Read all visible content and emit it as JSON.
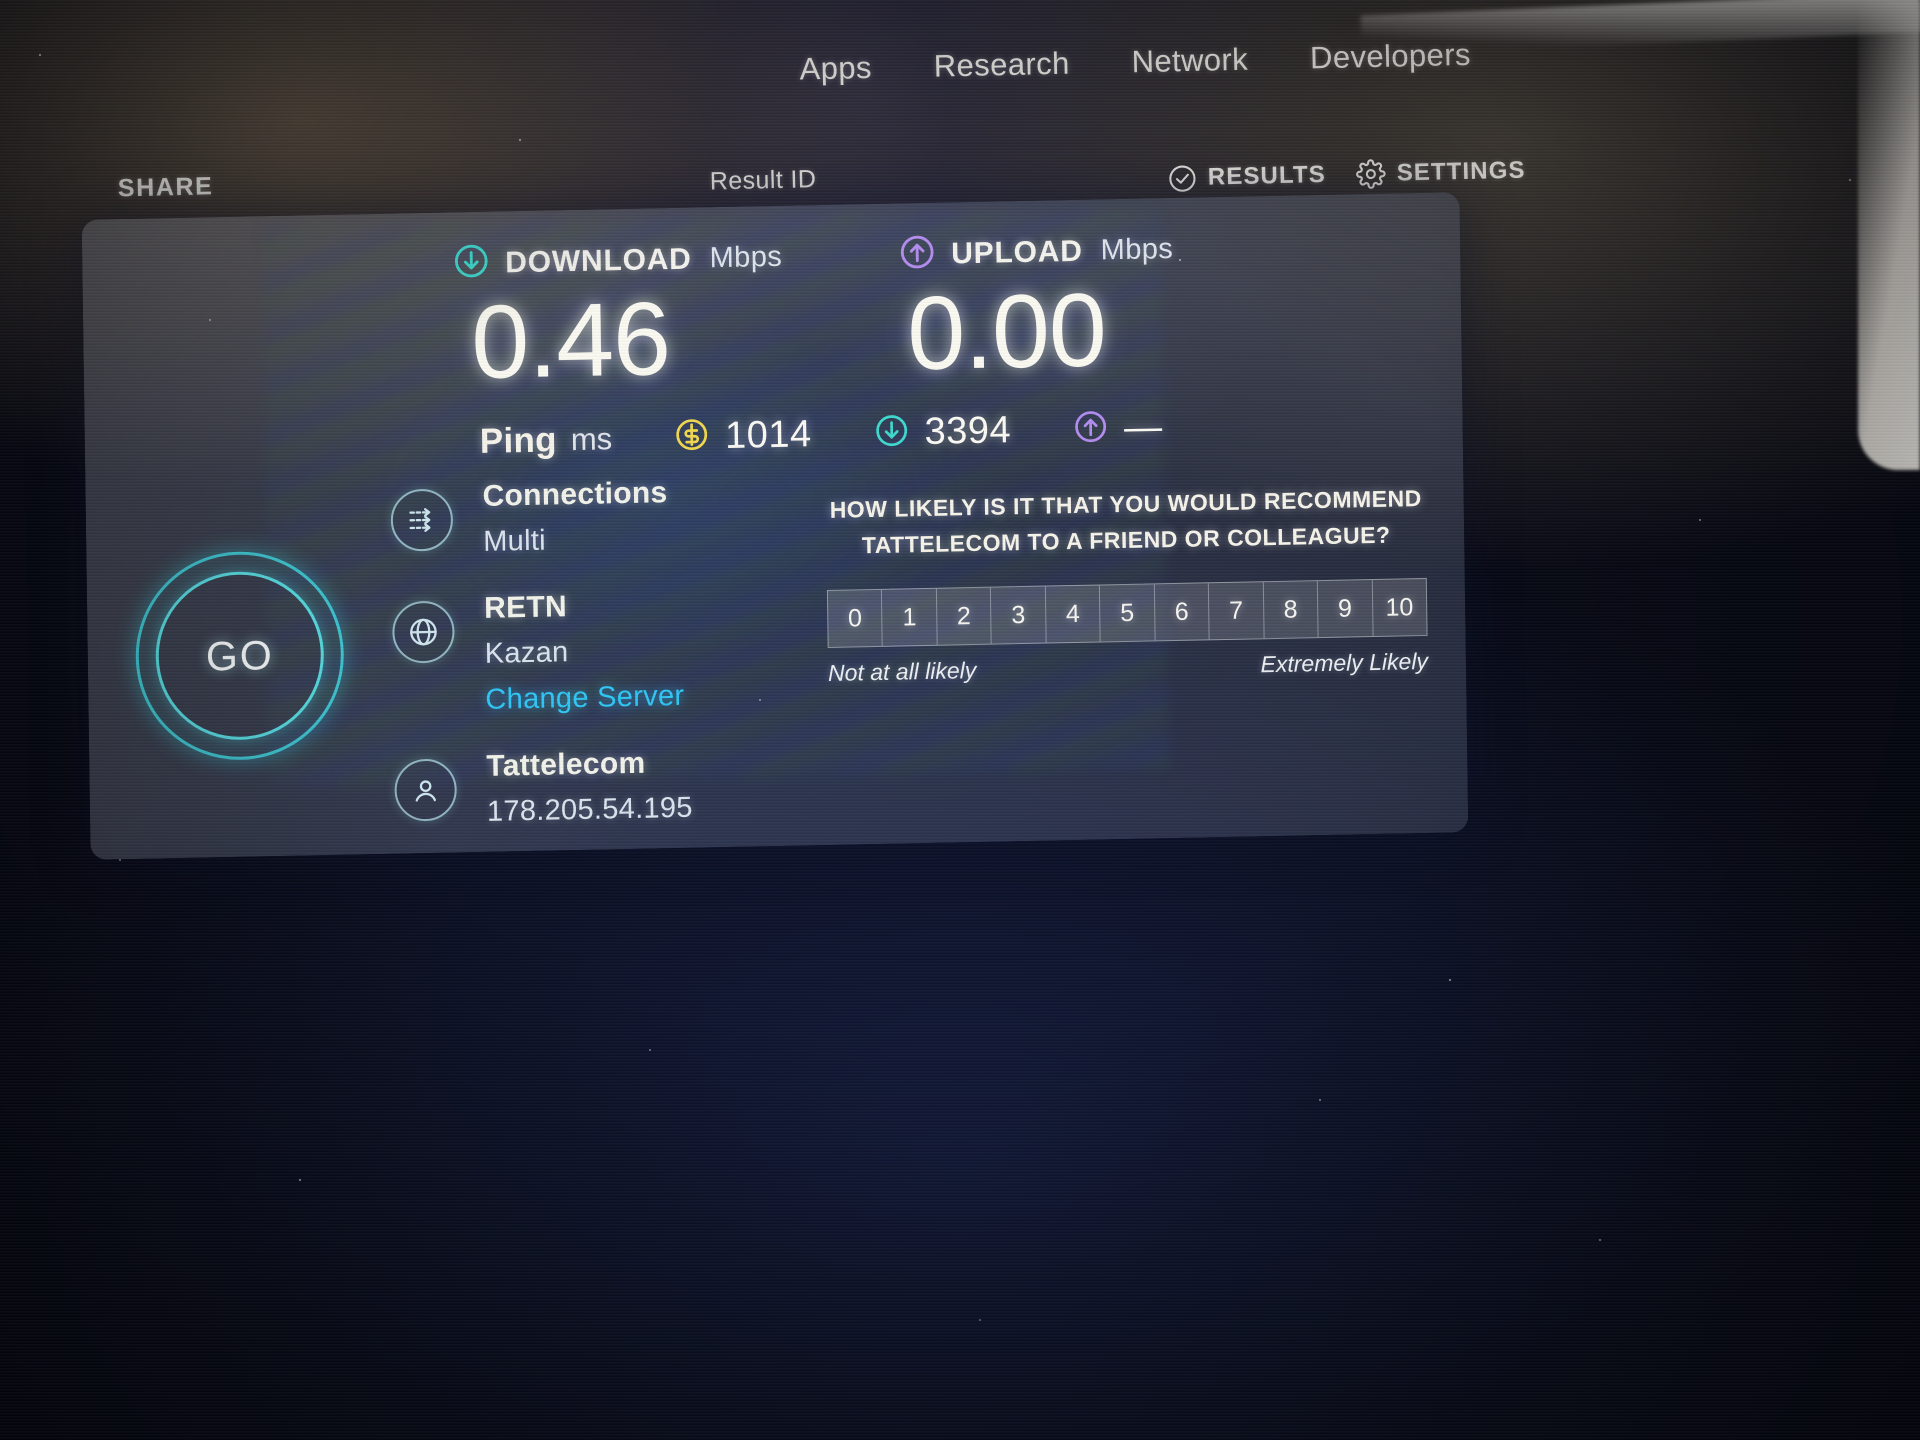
{
  "nav": {
    "items": [
      {
        "label": "Apps",
        "name": "nav-apps"
      },
      {
        "label": "Research",
        "name": "nav-research"
      },
      {
        "label": "Network",
        "name": "nav-network"
      },
      {
        "label": "Developers",
        "name": "nav-developers"
      }
    ]
  },
  "subbar": {
    "share_label": "SHARE",
    "result_id_label": "Result ID",
    "results_label": "RESULTS",
    "settings_label": "SETTINGS"
  },
  "result": {
    "download": {
      "caption": "DOWNLOAD",
      "unit": "Mbps",
      "value": "0.46",
      "icon": "download-arrow-icon",
      "color": "#3fd9cf"
    },
    "upload": {
      "caption": "UPLOAD",
      "unit": "Mbps",
      "value": "0.00",
      "icon": "upload-arrow-icon",
      "color": "#b48cf0"
    },
    "ping": {
      "label": "Ping",
      "unit": "ms",
      "idle_value": "1014",
      "download_value": "3394",
      "upload_value": "—",
      "idle_color": "#f2d84f",
      "download_color": "#3fd9cf",
      "upload_color": "#b48cf0"
    }
  },
  "go_button": {
    "label": "GO"
  },
  "info": {
    "connections": {
      "title": "Connections",
      "value": "Multi",
      "icon": "connections-arrows-icon"
    },
    "server": {
      "title": "RETN",
      "value": "Kazan",
      "change_label": "Change Server",
      "change_color": "#2fc6f5",
      "icon": "globe-icon"
    },
    "isp": {
      "title": "Tattelecom",
      "value": "178.205.54.195",
      "icon": "person-icon"
    }
  },
  "survey": {
    "question_line1": "HOW LIKELY IS IT THAT YOU WOULD RECOMMEND",
    "question_line2": "TATTELECOM TO A FRIEND OR COLLEAGUE?",
    "scale": [
      "0",
      "1",
      "2",
      "3",
      "4",
      "5",
      "6",
      "7",
      "8",
      "9",
      "10"
    ],
    "low_label": "Not at all likely",
    "high_label": "Extremely Likely"
  }
}
